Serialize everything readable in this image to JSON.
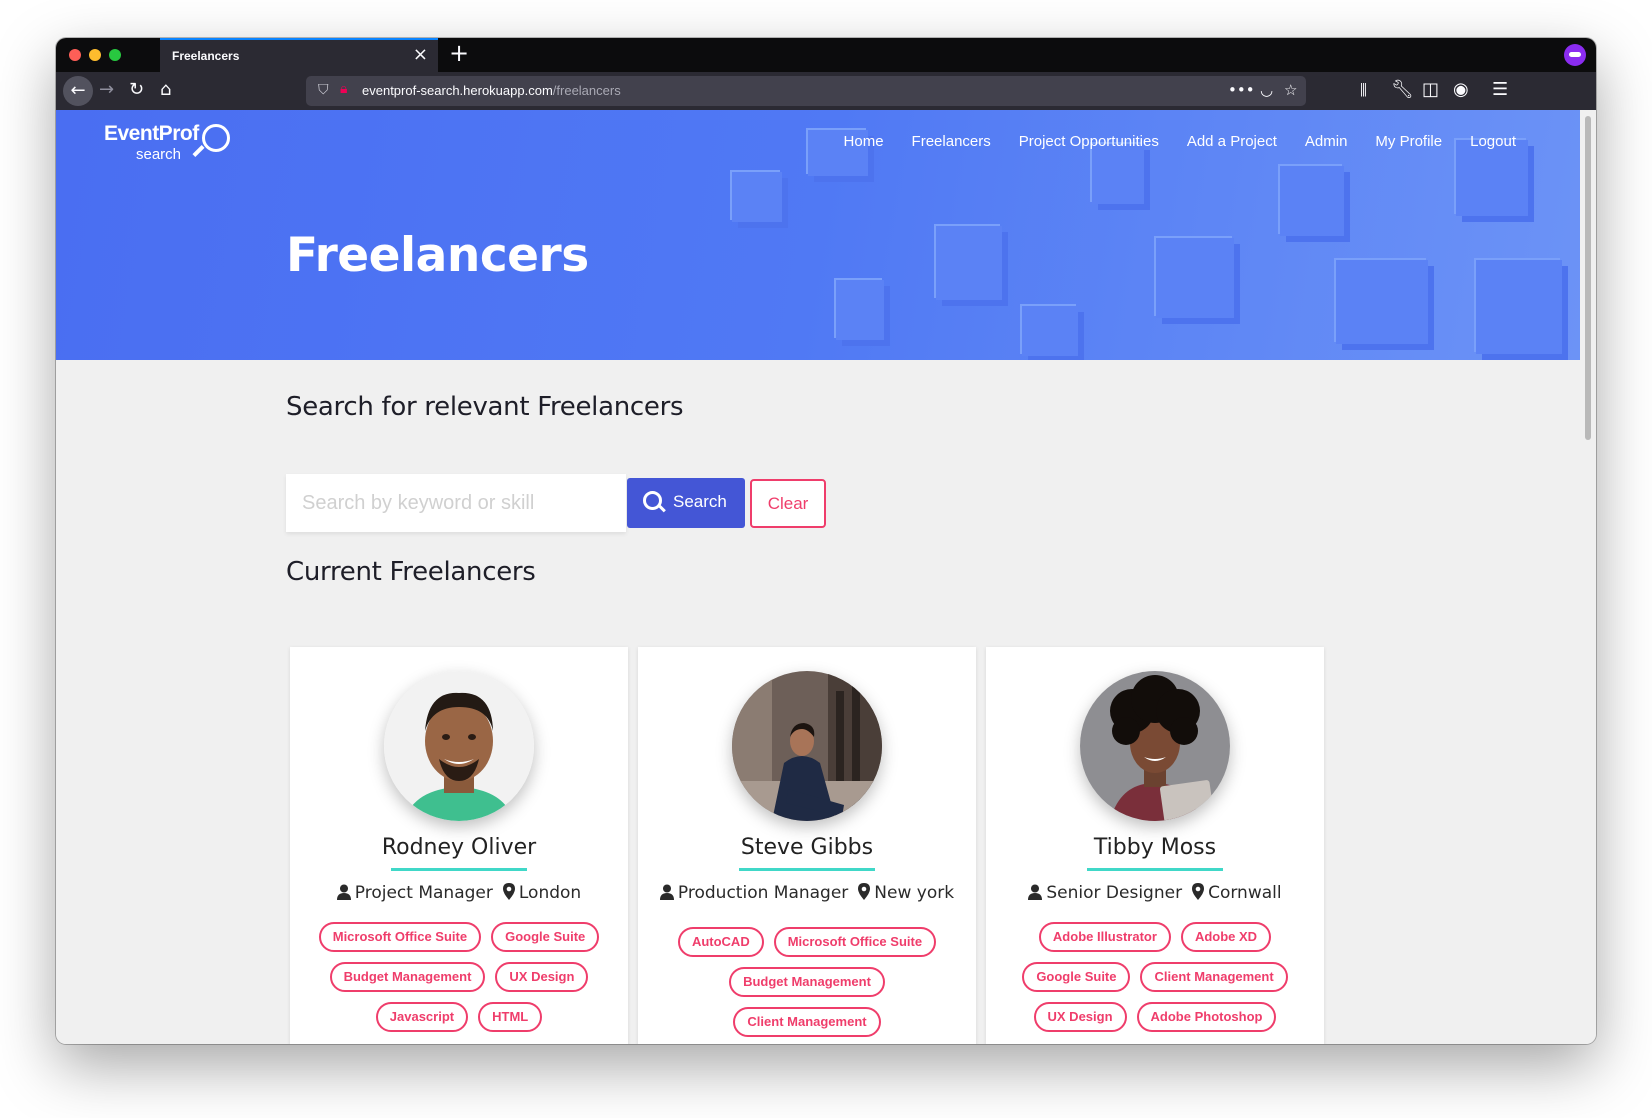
{
  "browser": {
    "tab_title": "Freelancers",
    "url_host": "eventprof-search.herokuapp.com",
    "url_path": "/freelancers"
  },
  "site": {
    "logo_main": "EventProf",
    "logo_sub": "search",
    "nav": [
      "Home",
      "Freelancers",
      "Project Opportunities",
      "Add a Project",
      "Admin",
      "My Profile",
      "Logout"
    ]
  },
  "hero": {
    "title": "Freelancers"
  },
  "search": {
    "heading": "Search for relevant Freelancers",
    "placeholder": "Search by keyword or skill",
    "search_label": "Search",
    "clear_label": "Clear"
  },
  "freelancers_heading": "Current Freelancers",
  "cards": [
    {
      "name": "Rodney Oliver",
      "role": "Project Manager",
      "location": "London",
      "skills": [
        "Microsoft Office Suite",
        "Google Suite",
        "Budget Management",
        "UX Design",
        "Javascript",
        "HTML"
      ]
    },
    {
      "name": "Steve Gibbs",
      "role": "Production Manager",
      "location": "New york",
      "skills": [
        "AutoCAD",
        "Microsoft Office Suite",
        "Budget Management",
        "Client Management"
      ]
    },
    {
      "name": "Tibby Moss",
      "role": "Senior Designer",
      "location": "Cornwall",
      "skills": [
        "Adobe Illustrator",
        "Adobe XD",
        "Google Suite",
        "Client Management",
        "UX Design",
        "Adobe Photoshop"
      ]
    }
  ],
  "colors": {
    "hero": "#4a6ef2",
    "search_button": "#4456d6",
    "accent_pink": "#ef3d6b",
    "name_underline": "#40d8c8"
  }
}
